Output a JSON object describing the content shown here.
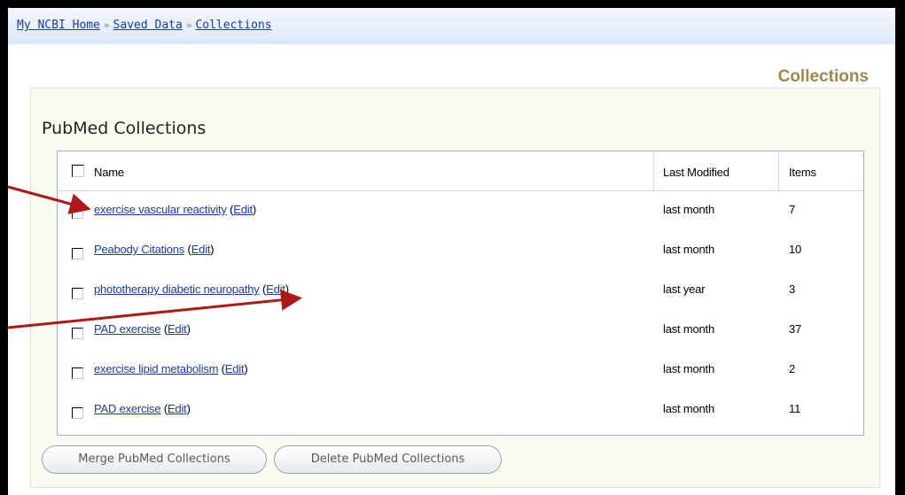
{
  "breadcrumb": {
    "items": [
      "My NCBI Home",
      "Saved Data",
      "Collections"
    ],
    "separator": "»"
  },
  "page": {
    "heading": "Collections"
  },
  "section": {
    "title": "PubMed Collections"
  },
  "table": {
    "headers": {
      "name": "Name",
      "last_modified": "Last Modified",
      "items": "Items"
    },
    "rows": [
      {
        "name": "exercise vascular reactivity",
        "edit": "Edit",
        "last_modified": "last month",
        "items": "7"
      },
      {
        "name": "Peabody Citations",
        "edit": "Edit",
        "last_modified": "last month",
        "items": "10"
      },
      {
        "name": "phototherapy diabetic neuropathy",
        "edit": "Edit",
        "last_modified": "last year",
        "items": "3"
      },
      {
        "name": "PAD exercise",
        "edit": "Edit",
        "last_modified": "last month",
        "items": "37"
      },
      {
        "name": "exercise lipid metabolism",
        "edit": "Edit",
        "last_modified": "last month",
        "items": "2"
      },
      {
        "name": "PAD exercise",
        "edit": "Edit",
        "last_modified": "last month",
        "items": "11"
      }
    ]
  },
  "buttons": {
    "merge": "Merge PubMed Collections",
    "delete": "Delete PubMed Collections"
  },
  "colors": {
    "link": "#1a3c9a",
    "heading": "#a0884c",
    "annotation_arrow": "#b01818"
  }
}
